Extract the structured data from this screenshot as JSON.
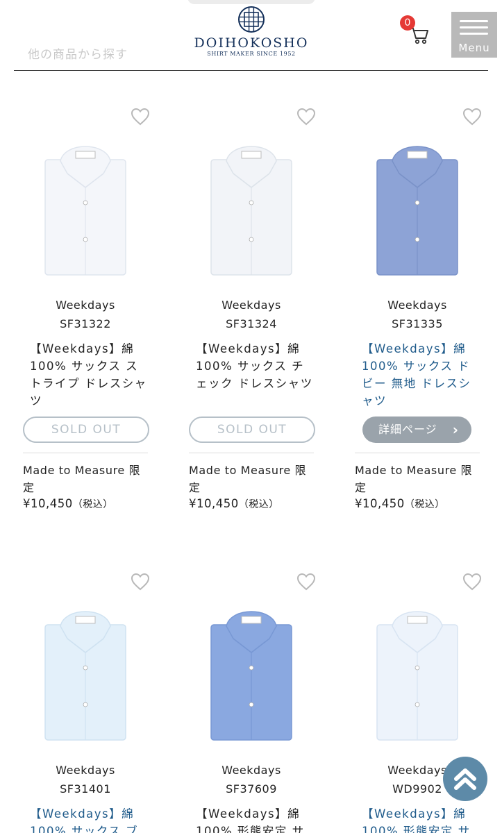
{
  "header": {
    "search_link": "他の商品から探す",
    "logo_name": "DOIHOKOSHO",
    "logo_tagline": "SHIRT MAKER SINCE 1952",
    "cart_count": "0",
    "menu_label": "Menu"
  },
  "products": [
    {
      "brand": "Weekdays",
      "code": "SF31322",
      "name": "【Weekdays】綿100% サックス ストライプ ドレスシャツ",
      "action": "SOLD OUT",
      "note": "Made to Measure 限定",
      "price": "¥10,450",
      "tax": "（税込）"
    },
    {
      "brand": "Weekdays",
      "code": "SF31324",
      "name": "【Weekdays】綿100% サックス チェック ドレスシャツ",
      "action": "SOLD OUT",
      "note": "Made to Measure 限定",
      "price": "¥10,450",
      "tax": "（税込）"
    },
    {
      "brand": "Weekdays",
      "code": "SF31335",
      "name": "【Weekdays】綿100% サックス ドビー 無地 ドレスシャツ",
      "action": "詳細ページ",
      "note": "Made to Measure 限定",
      "price": "¥10,450",
      "tax": "（税込）"
    },
    {
      "brand": "Weekdays",
      "code": "SF31401",
      "name": "【Weekdays】綿100% サックス ブ"
    },
    {
      "brand": "Weekdays",
      "code": "SF37609",
      "name": "【Weekdays】綿100% 形態安定 サ"
    },
    {
      "brand": "Weekdays",
      "code": "WD9902",
      "name": "【Weekdays】綿100% 形態安定 サ"
    }
  ],
  "colors": {
    "accent_navy": "#14305a",
    "link_blue": "#1e5a8a",
    "badge_red": "#e53935",
    "totop": "#5d8aa8"
  }
}
